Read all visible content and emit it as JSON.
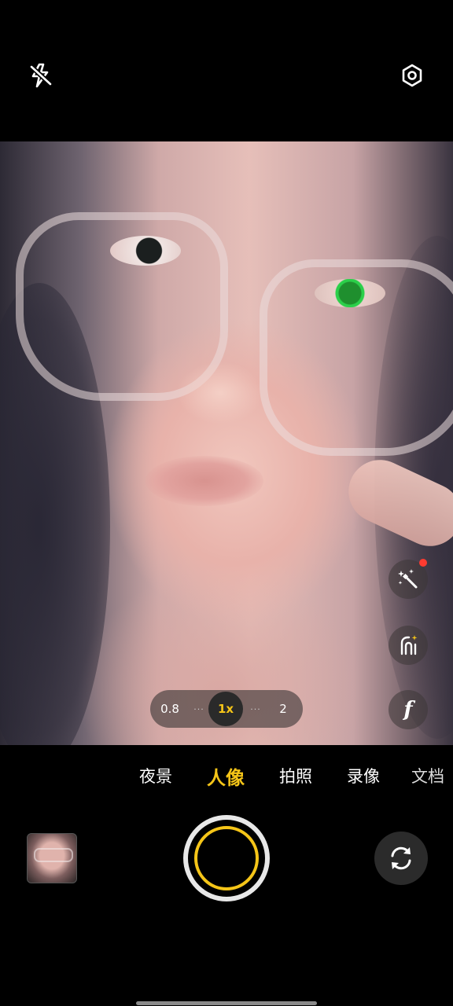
{
  "top_bar": {
    "flash_icon": "flash-off-icon",
    "settings_icon": "settings-icon"
  },
  "zoom": {
    "options": [
      "0.8",
      "1x",
      "2"
    ],
    "selected": "1x",
    "separator": "···"
  },
  "side_controls": [
    {
      "name": "beauty",
      "icon": "magic-wand-icon",
      "has_notification_dot": true
    },
    {
      "name": "portrait-effect",
      "icon": "portrait-sparkle-icon"
    },
    {
      "name": "aperture",
      "icon": "f-aperture-icon",
      "label": "f"
    }
  ],
  "modes": {
    "items": [
      "夜景",
      "人像",
      "拍照",
      "录像",
      "文档"
    ],
    "active": "人像"
  },
  "bottom_bar": {
    "thumbnail_icon": "gallery-thumbnail",
    "shutter_icon": "shutter-button",
    "flip_icon": "switch-camera-icon"
  },
  "colors": {
    "accent": "#f5c518",
    "notification": "#ff3b30",
    "background": "#000000"
  }
}
